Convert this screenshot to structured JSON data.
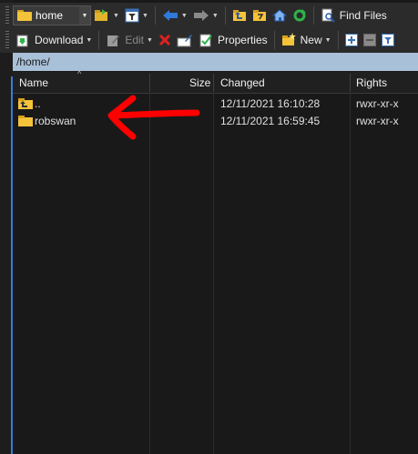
{
  "toolbar_top": {
    "location": "home",
    "find_files": "Find Files"
  },
  "toolbar_actions": {
    "download": "Download",
    "edit": "Edit",
    "properties": "Properties",
    "new": "New"
  },
  "path": "/home/",
  "columns": {
    "name": "Name",
    "size": "Size",
    "changed": "Changed",
    "rights": "Rights"
  },
  "files": [
    {
      "name": "..",
      "size": "",
      "changed": "12/11/2021 16:10:28",
      "rights": "rwxr-xr-x",
      "icon": "parent-folder-icon"
    },
    {
      "name": "robswan",
      "size": "",
      "changed": "12/11/2021 16:59:45",
      "rights": "rwxr-xr-x",
      "icon": "folder-icon"
    }
  ],
  "annotation": {
    "arrow_color": "#ff0000"
  },
  "colors": {
    "path_bar": "#a8c0d8",
    "background": "#191919",
    "folder": "#f5c33a"
  }
}
